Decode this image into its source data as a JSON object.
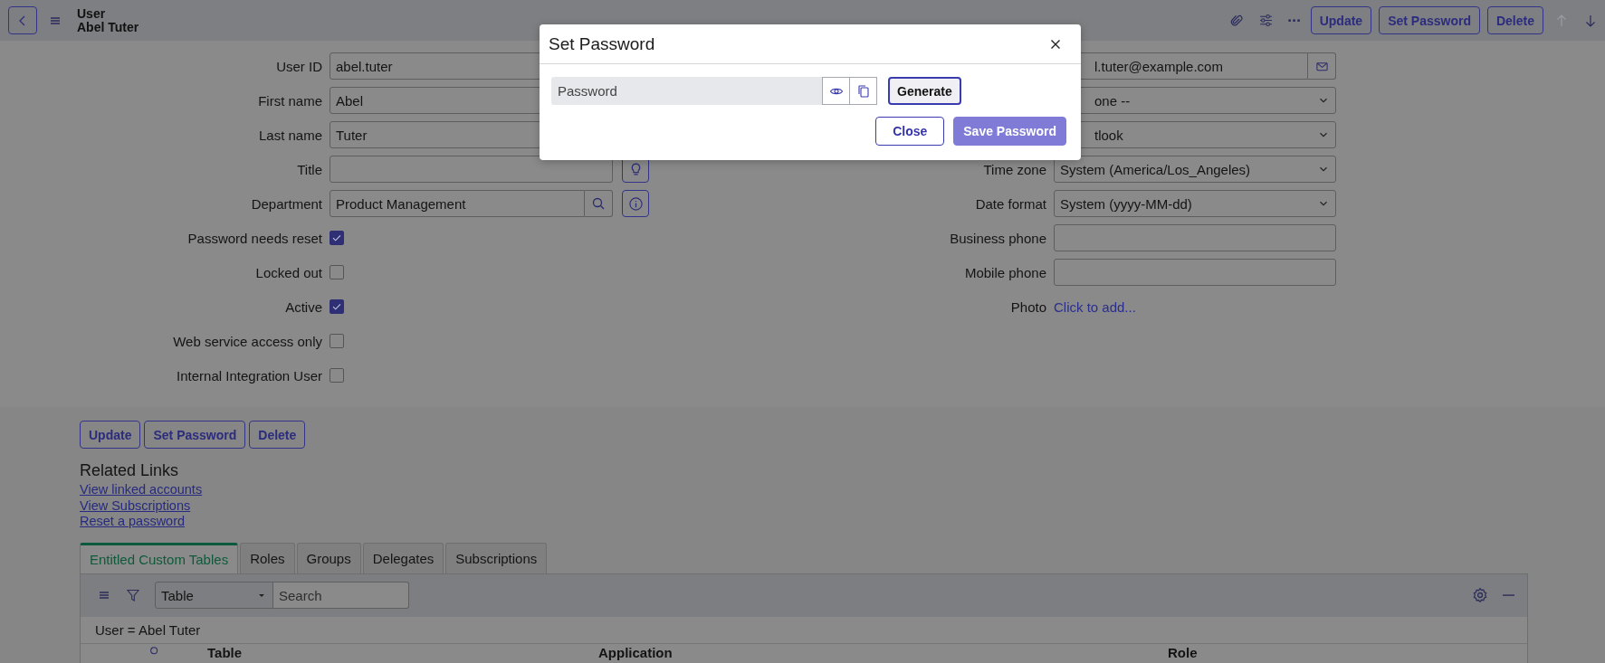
{
  "header": {
    "title": "User",
    "subtitle": "Abel Tuter",
    "actions": [
      "Update",
      "Set Password",
      "Delete"
    ],
    "nav": [
      {
        "kind": "up",
        "disabled": true
      },
      {
        "kind": "down",
        "disabled": false
      }
    ]
  },
  "form": {
    "left": [
      {
        "kind": "text",
        "label": "User ID",
        "value": "abel.tuter"
      },
      {
        "kind": "text",
        "label": "First name",
        "value": "Abel"
      },
      {
        "kind": "text",
        "label": "Last name",
        "value": "Tuter"
      },
      {
        "kind": "text",
        "label": "Title",
        "addon": {
          "kind": "lightbulb"
        }
      },
      {
        "kind": "reference",
        "label": "Department",
        "value": "Product Management",
        "addon": {
          "kind": "info"
        }
      },
      {
        "kind": "checkbox",
        "label": "Password needs reset",
        "checked": true
      },
      {
        "kind": "checkbox",
        "label": "Locked out",
        "checked": false
      },
      {
        "kind": "checkbox",
        "label": "Active",
        "checked": true
      },
      {
        "kind": "checkbox",
        "label": "Web service access only",
        "checked": false
      },
      {
        "kind": "checkbox",
        "label": "Internal Integration User",
        "checked": false
      }
    ],
    "right": [
      {
        "kind": "email",
        "value": "l.tuter@example.com"
      },
      {
        "kind": "select",
        "value": "one --"
      },
      {
        "kind": "select",
        "value": "tlook"
      },
      {
        "kind": "select",
        "label": "Time zone",
        "value": "System (America/Los_Angeles)"
      },
      {
        "kind": "select",
        "label": "Date format",
        "value": "System (yyyy-MM-dd)"
      },
      {
        "kind": "text",
        "label": "Business phone"
      },
      {
        "kind": "text",
        "label": "Mobile phone"
      },
      {
        "kind": "link",
        "label": "Photo",
        "value": "Click to add..."
      }
    ]
  },
  "actions": [
    "Update",
    "Set Password",
    "Delete"
  ],
  "related_links": {
    "title": "Related Links",
    "links": [
      "View linked accounts",
      "View Subscriptions",
      "Reset a password"
    ]
  },
  "related_list": {
    "tabs": [
      {
        "label": "Entitled Custom Tables",
        "selected": true
      },
      {
        "label": "Roles",
        "selected": false
      },
      {
        "label": "Groups",
        "selected": false
      },
      {
        "label": "Delegates",
        "selected": false
      },
      {
        "label": "Subscriptions",
        "selected": false
      }
    ],
    "filter_select": "Table",
    "search": {
      "placeholder": "Search"
    },
    "breadcrumb": "User = Abel Tuter",
    "columns": [
      "Table",
      "Application",
      "Role"
    ]
  },
  "modal": {
    "title": "Set Password",
    "password": {
      "placeholder": "Password"
    },
    "generate": "Generate",
    "buttons": [
      {
        "label": "Close",
        "disabled": false
      },
      {
        "label": "Save Password",
        "disabled": true
      }
    ]
  }
}
